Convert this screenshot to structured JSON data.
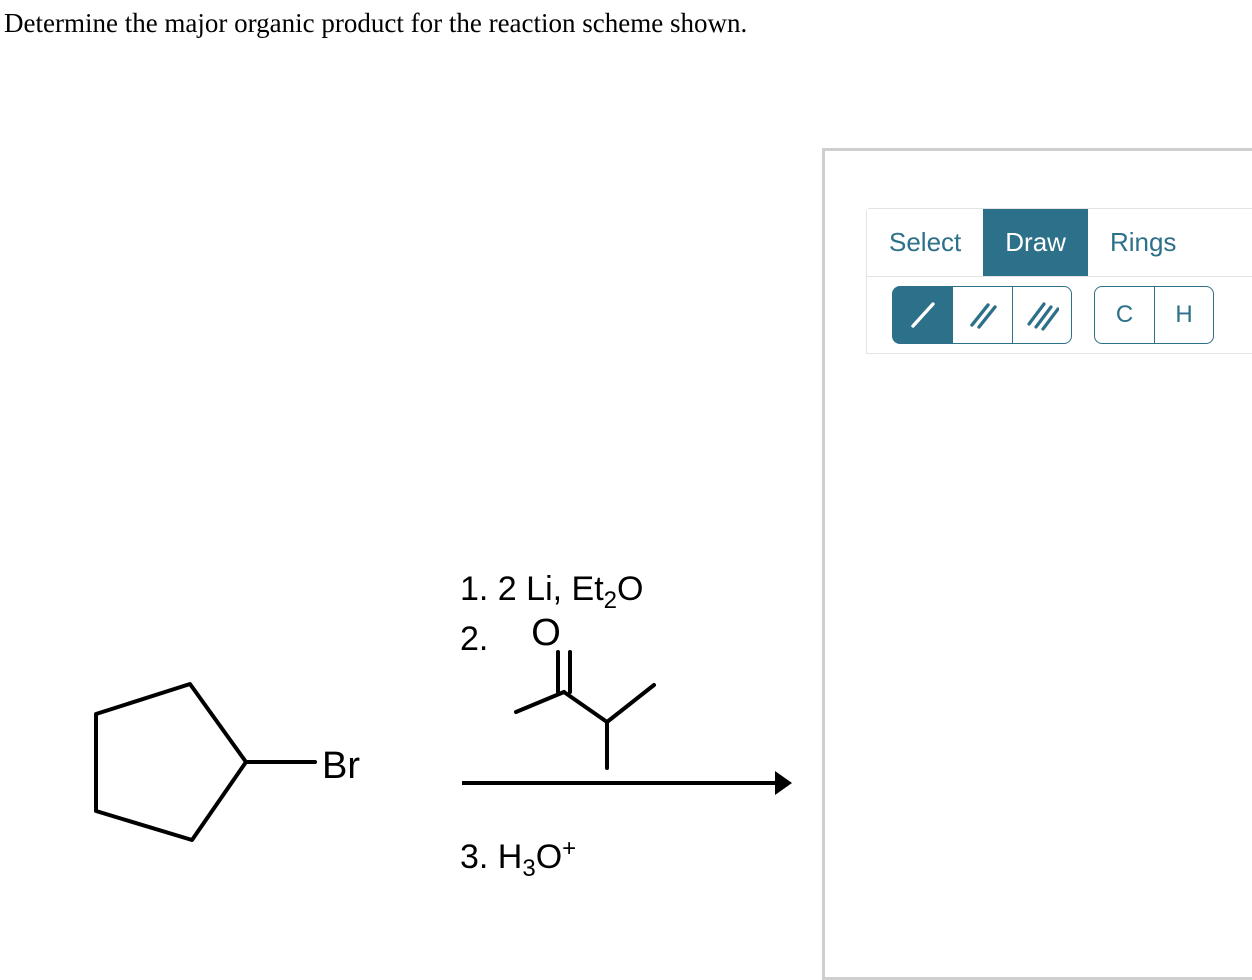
{
  "question": {
    "prompt": "Determine the major organic product for the reaction scheme shown."
  },
  "reaction": {
    "reactant": {
      "name": "bromocyclopentane",
      "ring_label": "cyclopentane",
      "substituent_label": "Br"
    },
    "conditions": {
      "step1": "1. 2 Li, Et",
      "step1_sub": "2",
      "step1_tail": "O",
      "step2": "2.",
      "step2_reagent_label": "O",
      "step2_name": "3-methyl-2-butanone",
      "step3": "3. H",
      "step3_sub": "3",
      "step3_tail": "O",
      "step3_sup": "+"
    },
    "arrow": "reaction-arrow"
  },
  "editor": {
    "tabs": [
      {
        "label": "Select",
        "active": false
      },
      {
        "label": "Draw",
        "active": true
      },
      {
        "label": "Rings",
        "active": false
      }
    ],
    "bond_tools": [
      {
        "name": "single-bond",
        "active": true
      },
      {
        "name": "double-bond",
        "active": false
      },
      {
        "name": "triple-bond",
        "active": false
      }
    ],
    "element_tools": [
      {
        "label": "C",
        "active": false
      },
      {
        "label": "H",
        "active": false
      }
    ]
  },
  "colors": {
    "accent": "#2d7089",
    "panel_border": "#cfcfcf",
    "group_border": "#e3e3e3",
    "ink": "#000000",
    "background": "#ffffff"
  }
}
